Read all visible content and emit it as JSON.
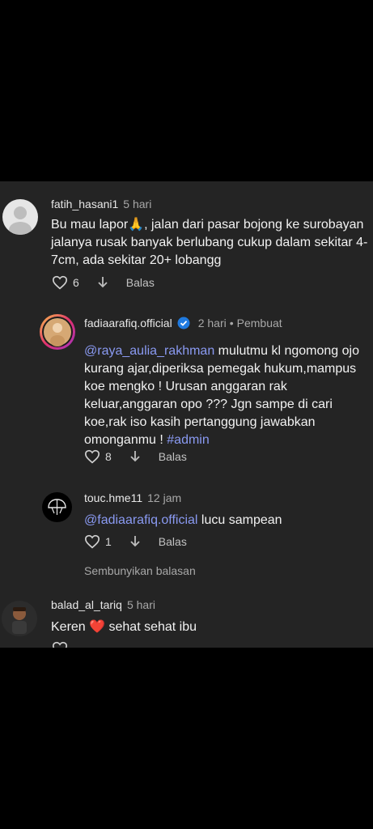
{
  "comments": [
    {
      "username": "fatih_hasani1",
      "time": "5 hari",
      "text_before_emoji": "Bu mau lapor",
      "emoji": "🙏",
      "text_after_emoji": ", jalan dari pasar bojong ke surobayan jalanya rusak banyak berlubang cukup dalam sekitar 4-7cm, ada sekitar 20+ lobangg",
      "likes": "6",
      "reply_label": "Balas"
    },
    {
      "username": "fadiaarafiq.official",
      "time": "2 hari",
      "separator": "•",
      "badge": "Pembuat",
      "mention": "@raya_aulia_rakhman",
      "text": " mulutmu kl ngomong ojo kurang ajar,diperiksa pemegak hukum,mampus koe mengko ! Urusan anggaran rak keluar,anggaran opo ??? Jgn sampe di cari koe,rak iso kasih pertanggung jawabkan omonganmu ! ",
      "hashtag": "#admin",
      "likes": "8",
      "reply_label": "Balas"
    },
    {
      "username": "touc.hme11",
      "time": "12 jam",
      "mention": "@fadiaarafiq.official",
      "text": " lucu sampean",
      "likes": "1",
      "reply_label": "Balas"
    },
    {
      "username": "balad_al_tariq",
      "time": "5 hari",
      "text_before_emoji": "Keren ",
      "emoji": "❤️",
      "text_after_emoji": " sehat sehat ibu"
    }
  ],
  "hide_replies_label": "Sembunyikan balasan",
  "colors": {
    "background": "#242424",
    "mention": "#8a9af2",
    "verified": "#1f7ae0",
    "heart": "#e5222e"
  },
  "icons": [
    "heart-outline-icon",
    "download-arrow-icon",
    "verified-badge-icon",
    "pray-emoji-icon",
    "heart-emoji-icon"
  ]
}
